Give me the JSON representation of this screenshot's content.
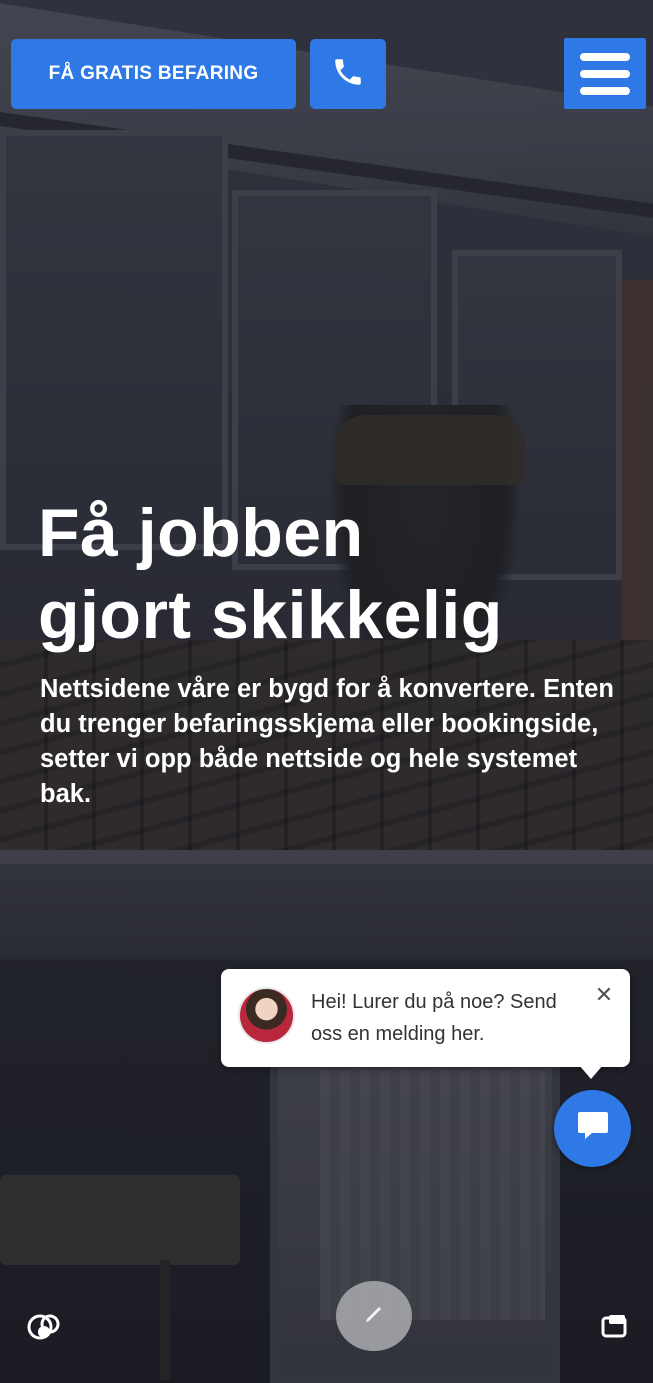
{
  "header": {
    "cta_label": "FÅ GRATIS BEFARING",
    "phone_icon": "phone-icon",
    "menu_icon": "hamburger-menu-icon"
  },
  "hero": {
    "headline_line1": "Få jobben",
    "headline_line2": "gjort skikkelig",
    "subtext": "Nettsidene våre er bygd for å konvertere. Enten du trenger befaringsskjema eller bookingside, setter vi opp både nettside og hele systemet bak."
  },
  "chat": {
    "message": "Hei! Lurer du på noe? Send oss en melding her.",
    "close_label": "✕",
    "fab_icon": "chat-bubble-icon"
  },
  "overlay_icons": {
    "left": "bubbles-icon",
    "center": "edit-pen-icon",
    "right": "screenshot-icon"
  },
  "colors": {
    "accent": "#2f79e7",
    "text": "#ffffff"
  }
}
